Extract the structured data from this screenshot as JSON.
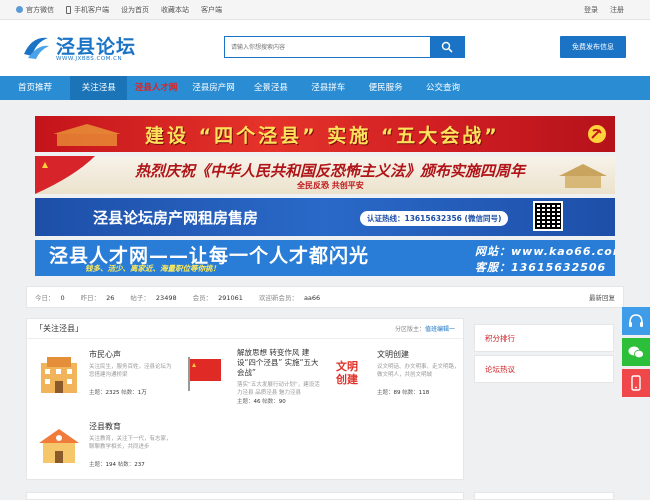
{
  "topbar": {
    "left": [
      "官方微信",
      "手机客户端",
      "设为首页",
      "收藏本站",
      "客户端"
    ],
    "right": [
      "登录",
      "注册"
    ]
  },
  "header": {
    "logo_text": "泾县论坛",
    "logo_sub": "WWW.JXBBS.COM.CN",
    "search_placeholder": "请输入你想搜索内容",
    "post_button": "免费发布信息"
  },
  "nav": [
    "首页推荐",
    "关注泾县",
    "泾县人才网",
    "泾县房产网",
    "全景泾县",
    "泾县拼车",
    "便民服务",
    "公交查询"
  ],
  "banners": {
    "b1": "建设 “四个泾县” 实施 “五大会战”",
    "b2_main": "热烈庆祝《中华人民共和国反恐怖主义法》颁布实施四周年",
    "b2_sub": "全民反恐  共创平安",
    "b3_main": "泾县论坛房产网租房售房",
    "b3_phone": "认证热线：13615632356 (微信同号)",
    "b4_main": "泾县人才网——让每一个人才都闪光",
    "b4_sub": "钱多、活少、离家近、海量职位等你挑！",
    "b4_site": "网站：www.kao66.com",
    "b4_phone": "客服：13615632506"
  },
  "stats": {
    "today_label": "今日：",
    "today": "0",
    "yesterday_label": "昨日：",
    "yesterday": "26",
    "posts_label": "帖子：",
    "posts": "23498",
    "members_label": "会员：",
    "members": "291061",
    "welcome_label": "欢迎新会员：",
    "welcome": "aa66",
    "newest": "最新回复"
  },
  "forum": {
    "title": "关注泾县",
    "moderator_label": "分区版主：",
    "moderator": "值班编辑一",
    "boards": [
      {
        "name": "市民心声",
        "desc": "关注民生，服务百姓，泾县论坛为您搭建沟通桥梁",
        "topics_label": "主题：",
        "topics": "2325",
        "posts_label": "帖数：",
        "posts": "1万"
      },
      {
        "name": "解放思想 转变作风 建设“四个泾县” 实施“五大会战”",
        "desc": "落实“五大发展行动计划”，建设活力泾县 品质泾县 魅力泾县",
        "topics_label": "主题：",
        "topics": "46",
        "posts_label": "帖数：",
        "posts": "90"
      },
      {
        "name": "文明创建",
        "desc": "议文明话、办文明事、走文明路，做文明人，共创文明城",
        "topics_label": "主题：",
        "topics": "89",
        "posts_label": "帖数：",
        "posts": "118"
      },
      {
        "name": "泾县教育",
        "desc": "关注教育，关注下一代，有志家，聊聊教学相长，共同进步",
        "topics_label": "主题：",
        "topics": "194",
        "posts_label": "帖数：",
        "posts": "237"
      }
    ],
    "wenming_icon_text": "文明创建"
  },
  "sidebar": [
    "积分排行",
    "论坛热议"
  ],
  "colors": {
    "brand_blue": "#1a73c5",
    "nav_blue": "#2a8dd4",
    "hot_red": "#e02020"
  }
}
